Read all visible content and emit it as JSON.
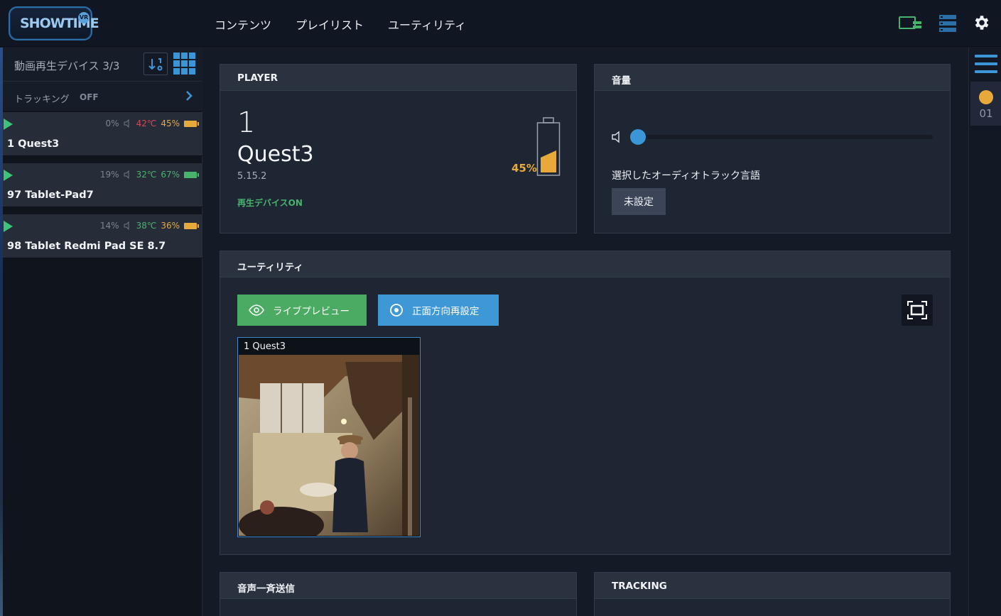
{
  "app": {
    "logo_text": "SHOWTIME",
    "logo_badge": "VR",
    "accent": "#3b96d8",
    "green": "#4cab62",
    "orange": "#e7a93a"
  },
  "nav": {
    "items": [
      {
        "label": "コンテンツ"
      },
      {
        "label": "プレイリスト"
      },
      {
        "label": "ユーティリティ"
      }
    ]
  },
  "top_icons": [
    "screen-icon",
    "server-stack-icon",
    "gear-icon"
  ],
  "sidebar": {
    "title": "動画再生デバイス 3/3",
    "tracking_label": "トラッキング",
    "tracking_value": "OFF",
    "devices": [
      {
        "name": "1  Quest3",
        "volume": "0%",
        "temp": "42℃",
        "battery": "45%",
        "battery_level": 45
      },
      {
        "name": "97  Tablet-Pad7",
        "volume": "19%",
        "temp": "32℃",
        "battery": "67%",
        "battery_level": 67
      },
      {
        "name": "98  Tablet Redmi Pad SE 8.7",
        "volume": "14%",
        "temp": "38℃",
        "battery": "36%",
        "battery_level": 36
      }
    ]
  },
  "rail": {
    "number": "01"
  },
  "player": {
    "header": "PLAYER",
    "number": "1",
    "name": "Quest3",
    "version": "5.15.2",
    "status": "再生デバイスON",
    "battery": "45%",
    "battery_level": 45
  },
  "volume": {
    "header": "音量",
    "level": 0,
    "audio_track_label": "選択したオーディオトラック言語",
    "audio_track_value": "未設定"
  },
  "utility": {
    "header": "ユーティリティ",
    "live_preview": "ライブプレビュー",
    "reset_direction": "正面方向再設定",
    "preview_label": "1 Quest3"
  },
  "bottom_panels": {
    "broadcast": "音声一斉送信",
    "tracking": "TRACKING"
  }
}
